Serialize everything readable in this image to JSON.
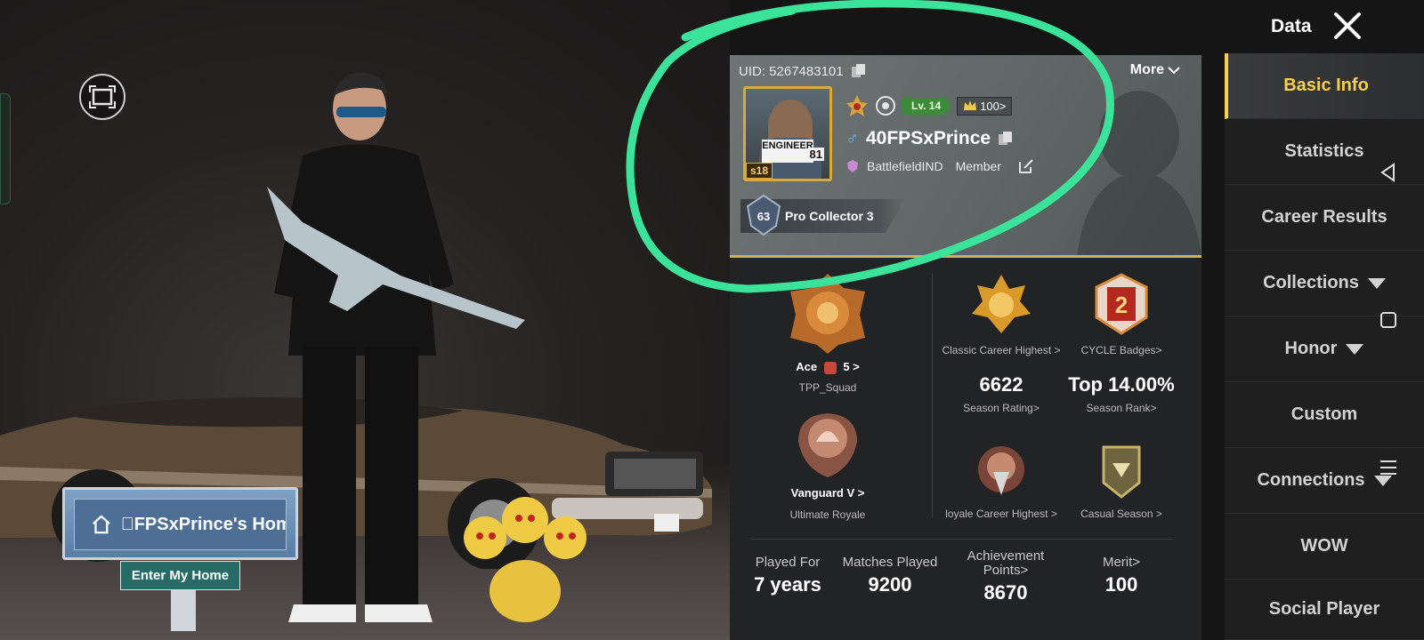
{
  "header": {
    "title": "Data",
    "close_icon": "close-icon"
  },
  "profile": {
    "uid": "UID: 5267483101",
    "more_label": "More",
    "avatar_sign": "ENGINEER",
    "avatar_number": "81",
    "season": "s18",
    "level": "Lv. 14",
    "popularity": "100>",
    "player_name": "40FPSxPrince",
    "clan": "BattlefieldIND",
    "clan_role": "Member",
    "title_level": "63",
    "title_name": "Pro Collector 3"
  },
  "stats": {
    "tier_label": "Ace",
    "tier_stars": "5 >",
    "tier_mode": "TPP_Squad",
    "classic_highest": "Classic Career Highest >",
    "cycle_badges": "CYCLE Badges>",
    "cycle_badge_number": "2",
    "season_rating_value": "6622",
    "season_rating_label": "Season Rating>",
    "season_rank_value": "Top 14.00%",
    "season_rank_label": "Season Rank>",
    "vanguard_label": "Vanguard V >",
    "vanguard_mode": "Ultimate Royale",
    "royale_highest": "loyale Career Highest >",
    "casual_season": "Casual Season >"
  },
  "summary": [
    {
      "label": "Played For",
      "value": "7 years"
    },
    {
      "label": "Matches Played",
      "value": "9200"
    },
    {
      "label": "Achievement Points>",
      "value": "8670"
    },
    {
      "label": "Merit>",
      "value": "100"
    }
  ],
  "home": {
    "sign_label": "\u0000FPSxPrince's Home",
    "enter_label": "Enter My Home"
  },
  "sidebar": {
    "items": [
      {
        "label": "Basic Info",
        "active": true
      },
      {
        "label": "Statistics"
      },
      {
        "label": "Career Results"
      },
      {
        "label": "Collections",
        "dropdown": true
      },
      {
        "label": "Honor",
        "dropdown": true
      },
      {
        "label": "Custom"
      },
      {
        "label": "Connections",
        "dropdown": true
      },
      {
        "label": "WOW"
      },
      {
        "label": "Social Player"
      }
    ]
  },
  "colors": {
    "accent": "#f7d24a",
    "annotation": "#3be39a",
    "level_green": "#3c8a3a"
  }
}
